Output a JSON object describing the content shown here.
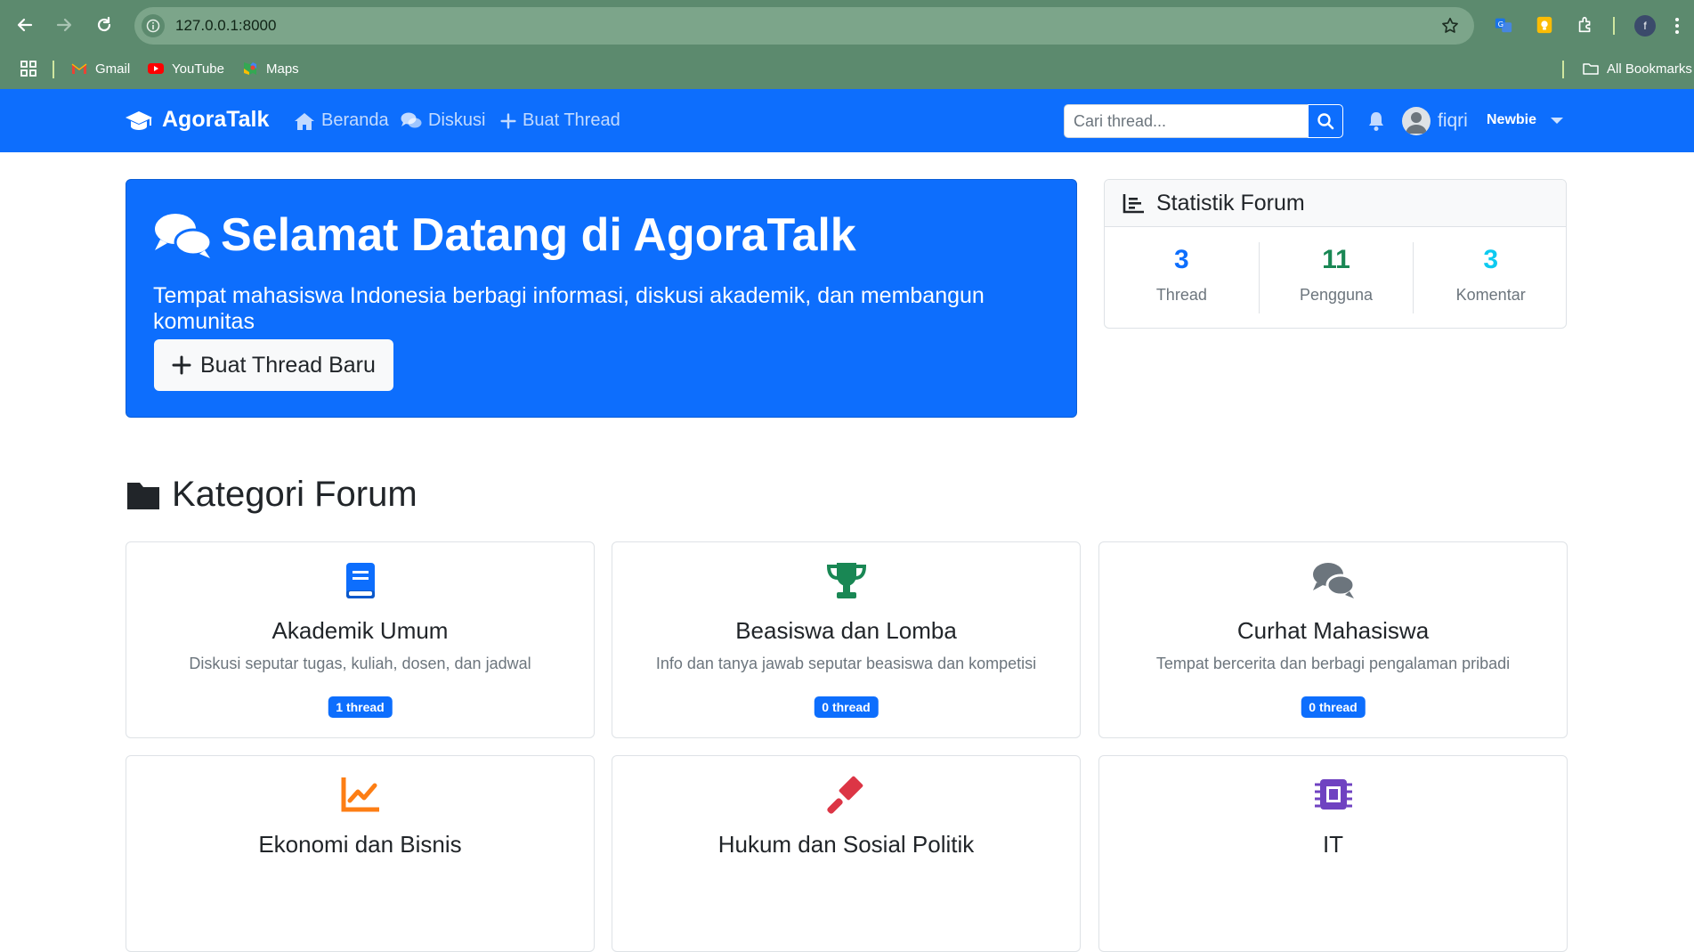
{
  "browser": {
    "url": "127.0.0.1:8000",
    "profile_initial": "f",
    "bookmarks": [
      {
        "label": "Gmail",
        "icon": "gmail-icon"
      },
      {
        "label": "YouTube",
        "icon": "youtube-icon"
      },
      {
        "label": "Maps",
        "icon": "maps-icon"
      }
    ],
    "all_bookmarks": "All Bookmarks"
  },
  "navbar": {
    "brand": "AgoraTalk",
    "links": [
      {
        "label": "Beranda",
        "icon": "home-icon"
      },
      {
        "label": "Diskusi",
        "icon": "comments-icon"
      },
      {
        "label": "Buat Thread",
        "icon": "plus-icon"
      }
    ],
    "search_placeholder": "Cari thread...",
    "username": "fiqri",
    "rank": "Newbie"
  },
  "hero": {
    "title": "Selamat Datang di AgoraTalk",
    "subtitle": "Tempat mahasiswa Indonesia berbagi informasi, diskusi akademik, dan membangun komunitas",
    "button": "Buat Thread Baru"
  },
  "stats": {
    "title": "Statistik Forum",
    "items": [
      {
        "value": "3",
        "label": "Thread",
        "color": "#0d6efd"
      },
      {
        "value": "11",
        "label": "Pengguna",
        "color": "#198754"
      },
      {
        "value": "3",
        "label": "Komentar",
        "color": "#0dcaf0"
      }
    ]
  },
  "categories": {
    "title": "Kategori Forum",
    "items": [
      {
        "name": "Akademik Umum",
        "description": "Diskusi seputar tugas, kuliah, dosen, dan jadwal",
        "badge": "1 thread",
        "icon": "book-icon",
        "color": "#0d6efd"
      },
      {
        "name": "Beasiswa dan Lomba",
        "description": "Info dan tanya jawab seputar beasiswa dan kompetisi",
        "badge": "0 thread",
        "icon": "trophy-icon",
        "color": "#198754"
      },
      {
        "name": "Curhat Mahasiswa",
        "description": "Tempat bercerita dan berbagi pengalaman pribadi",
        "badge": "0 thread",
        "icon": "comments-icon",
        "color": "#6c757d"
      },
      {
        "name": "Ekonomi dan Bisnis",
        "icon": "chart-line-icon",
        "color": "#fd7e14"
      },
      {
        "name": "Hukum dan Sosial Politik",
        "icon": "gavel-icon",
        "color": "#dc3545"
      },
      {
        "name": "IT",
        "icon": "microchip-icon",
        "color": "#6f42c1"
      }
    ]
  }
}
